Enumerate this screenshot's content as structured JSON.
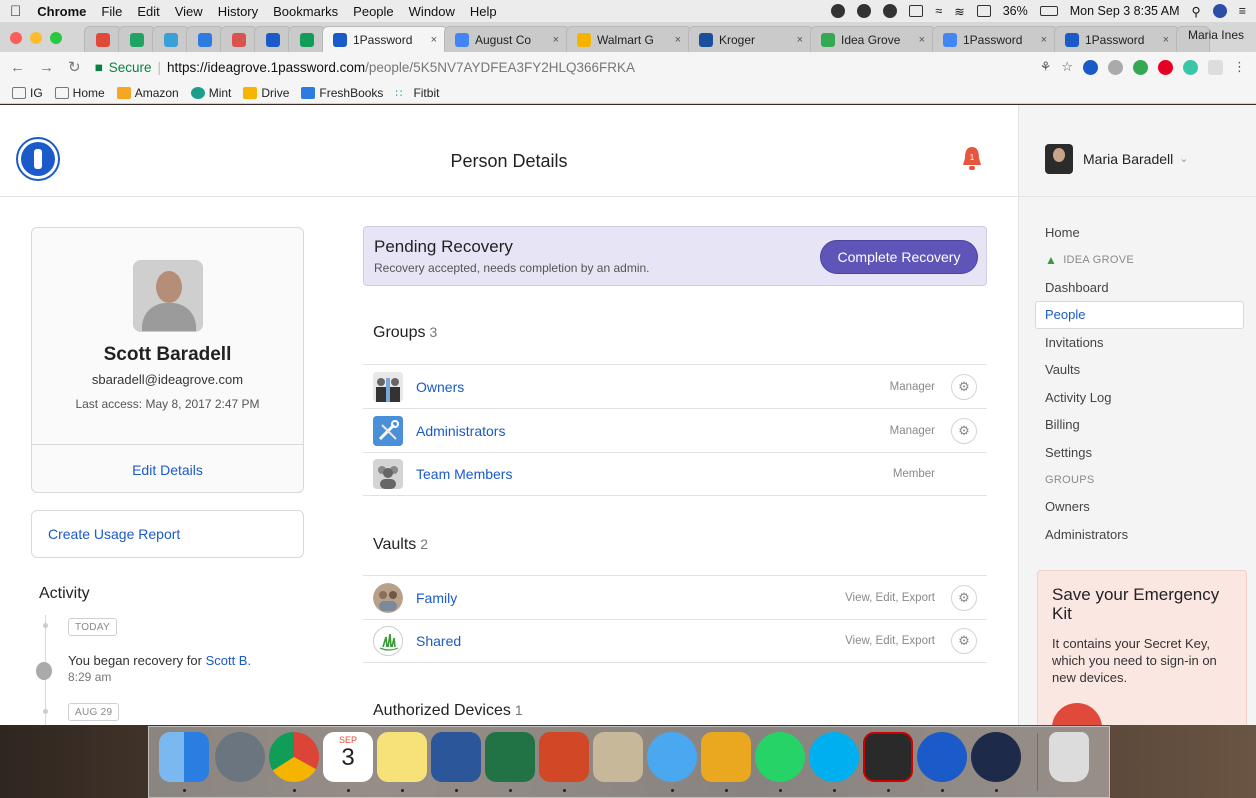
{
  "menubar": {
    "app": "Chrome",
    "items": [
      "File",
      "Edit",
      "View",
      "History",
      "Bookmarks",
      "People",
      "Window",
      "Help"
    ],
    "battery": "36%",
    "datetime": "Mon Sep 3  8:35 AM"
  },
  "browser": {
    "tabs": [
      {
        "label": "",
        "color": "#e04a3a"
      },
      {
        "label": "",
        "color": "#1fa463"
      },
      {
        "label": "",
        "color": "#3aa0d8"
      },
      {
        "label": "",
        "color": "#2d7be0"
      },
      {
        "label": "",
        "color": "#d9534f"
      },
      {
        "label": "",
        "color": "#1a5ac9"
      },
      {
        "label": "",
        "color": "#0f9d58"
      },
      {
        "label": "1Password",
        "color": "#1a5ac9",
        "active": true
      },
      {
        "label": "August Co",
        "color": "#4285f4"
      },
      {
        "label": "Walmart G",
        "color": "#f4b400"
      },
      {
        "label": "Kroger",
        "color": "#1b4f9c"
      },
      {
        "label": "Idea Grove",
        "color": "#34a853"
      },
      {
        "label": "1Password",
        "color": "#4285f4"
      },
      {
        "label": "1Password",
        "color": "#1a5ac9"
      }
    ],
    "profile": "Maria Ines",
    "secure_label": "Secure",
    "url_host": "https://ideagrove.1password.com",
    "url_path": "/people/5K5NV7AYDFEA3FY2HLQ366FRKA",
    "bookmarks": [
      "IG",
      "Home",
      "Amazon",
      "Mint",
      "Drive",
      "FreshBooks",
      "Fitbit"
    ]
  },
  "header": {
    "title": "Person Details",
    "notification_count": "1"
  },
  "sidebar": {
    "user_name": "Maria Baradell",
    "nav": [
      "Home"
    ],
    "org_label": "IDEA GROVE",
    "org_nav": [
      "Dashboard",
      "People",
      "Invitations",
      "Vaults",
      "Activity Log",
      "Billing",
      "Settings"
    ],
    "active_item": "People",
    "groups_label": "GROUPS",
    "groups": [
      "Owners",
      "Administrators"
    ],
    "kit_title": "Save your Emergency Kit",
    "kit_body": "It contains your Secret Key, which you need to sign-in on new devices."
  },
  "person": {
    "name": "Scott Baradell",
    "email": "sbaradell@ideagrove.com",
    "last_access": "Last access: May 8, 2017 2:47 PM",
    "edit_label": "Edit Details",
    "usage_report": "Create Usage Report"
  },
  "activity": {
    "title": "Activity",
    "entries": [
      {
        "date": "TODAY",
        "text": "You began recovery for ",
        "link": "Scott B.",
        "time": "8:29 am"
      },
      {
        "date": "AUG 29"
      }
    ]
  },
  "recovery": {
    "title": "Pending Recovery",
    "subtitle": "Recovery accepted, needs completion by an admin.",
    "button": "Complete Recovery"
  },
  "groups": {
    "title": "Groups",
    "count": "3",
    "items": [
      {
        "name": "Owners",
        "role": "Manager",
        "gear": true
      },
      {
        "name": "Administrators",
        "role": "Manager",
        "gear": true
      },
      {
        "name": "Team Members",
        "role": "Member",
        "gear": false
      }
    ]
  },
  "vaults": {
    "title": "Vaults",
    "count": "2",
    "items": [
      {
        "name": "Family",
        "role": "View, Edit, Export",
        "gear": true
      },
      {
        "name": "Shared",
        "role": "View, Edit, Export",
        "gear": true
      }
    ]
  },
  "devices": {
    "title": "Authorized Devices",
    "count": "1"
  },
  "dock": {
    "apps": [
      "finder-icon",
      "launchpad-icon",
      "chrome-icon",
      "calendar-icon",
      "notes-icon",
      "word-icon",
      "excel-icon",
      "powerpoint-icon",
      "calculator-icon",
      "messages-icon",
      "slack-icon",
      "whatsapp-icon",
      "skype-icon",
      "acrobat-icon",
      "1password-icon",
      "quicktime-icon",
      "trash-icon"
    ],
    "calendar_month": "SEP",
    "calendar_day": "3"
  }
}
